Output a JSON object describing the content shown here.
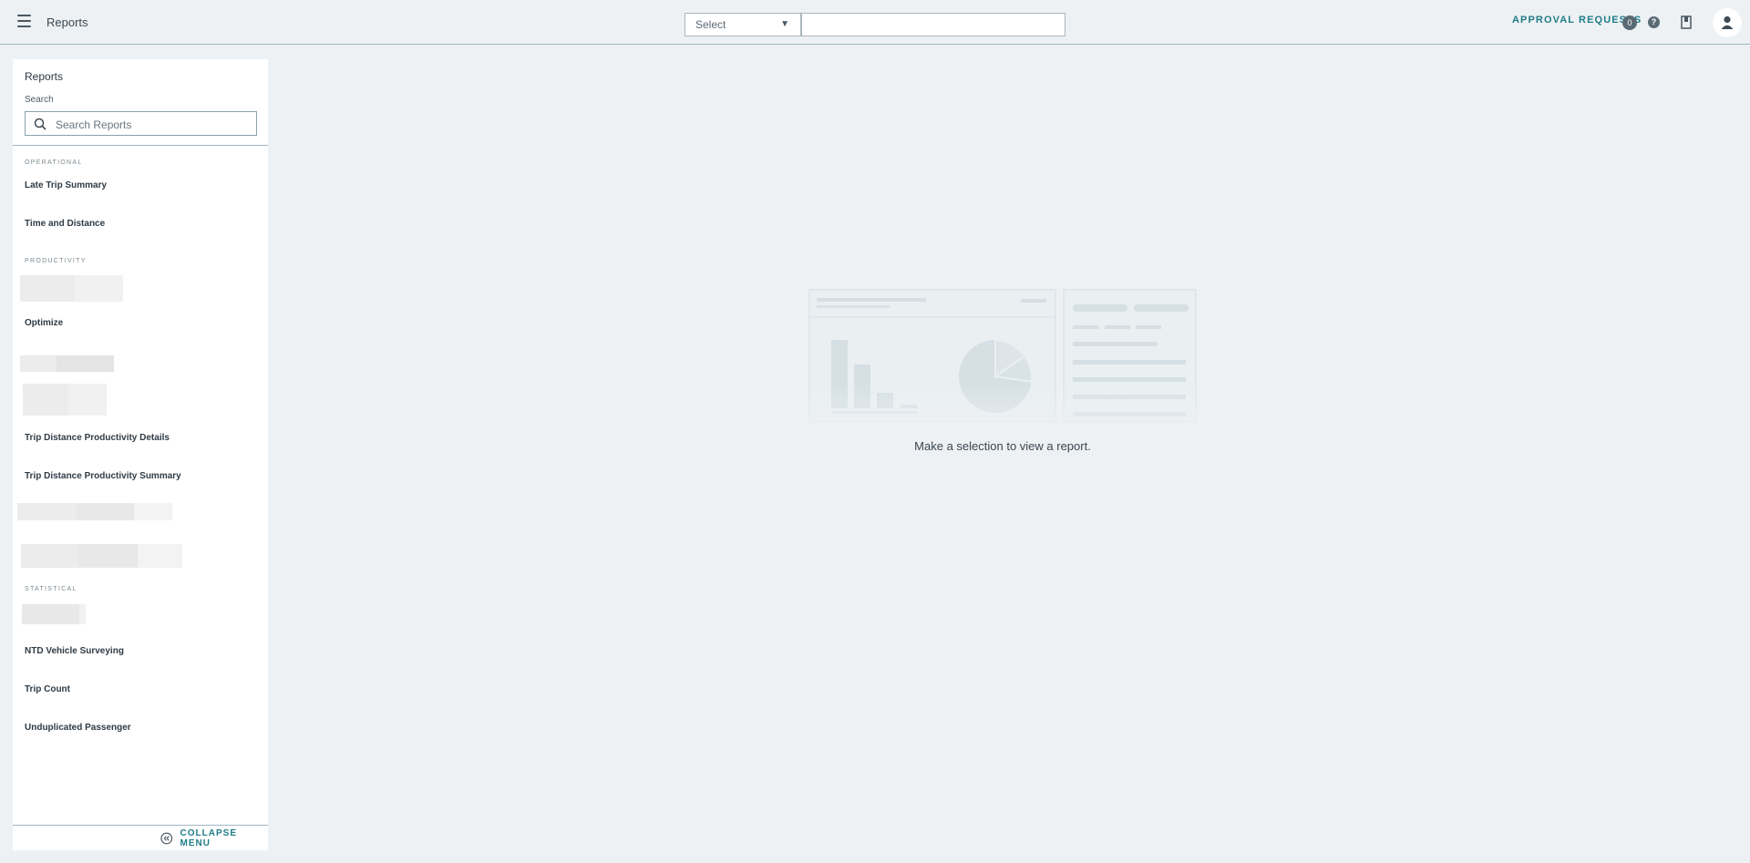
{
  "header": {
    "app_title": "Reports",
    "select_value": "Select",
    "approval_label": "APPROVAL REQUESTS",
    "approval_count": "0",
    "help_glyph": "?"
  },
  "sidebar": {
    "title": "Reports",
    "search_label": "Search",
    "search_placeholder": "Search Reports",
    "sections": {
      "operational": "OPERATIONAL",
      "productivity": "PRODUCTIVITY",
      "statistical": "STATISTICAL"
    },
    "reports": {
      "late_trip_summary": "Late Trip Summary",
      "time_and_distance": "Time and Distance",
      "optimize": "Optimize",
      "trip_distance_productivity_details": "Trip Distance Productivity Details",
      "trip_distance_productivity_summary": "Trip Distance Productivity Summary",
      "ntd_vehicle_surveying": "NTD Vehicle Surveying",
      "trip_count": "Trip Count",
      "unduplicated_passenger": "Unduplicated Passenger"
    },
    "collapse_label": "COLLAPSE MENU"
  },
  "main": {
    "empty_message": "Make a selection to view a report."
  },
  "icons": {
    "menu": "hamburger-menu-icon",
    "help": "question-icon",
    "book": "bookmark-book-icon",
    "avatar": "user-avatar-icon",
    "search": "search-icon",
    "collapse": "double-chevron-left-icon",
    "select_caret": "caret-down-icon"
  },
  "colors": {
    "accent": "#1f7d86",
    "background": "#edf1f4",
    "panel": "#ffffff"
  }
}
